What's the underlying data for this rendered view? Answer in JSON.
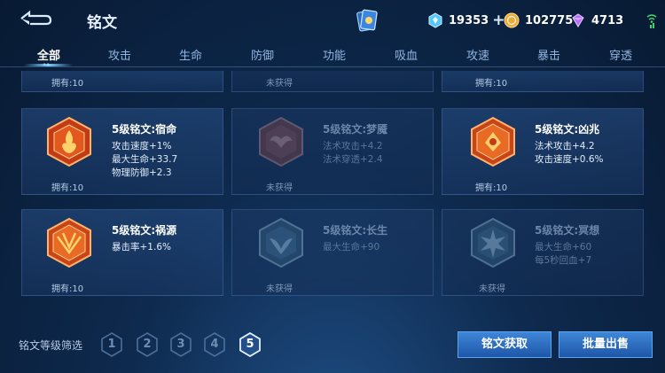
{
  "header": {
    "title": "铭文",
    "currencies": [
      {
        "name": "diamond",
        "value": "19353"
      },
      {
        "name": "gold",
        "value": "102775"
      },
      {
        "name": "gem",
        "value": "4713"
      }
    ],
    "plus": "+"
  },
  "tabs": [
    "全部",
    "攻击",
    "生命",
    "防御",
    "功能",
    "吸血",
    "攻速",
    "暴击",
    "穿透"
  ],
  "tab_dots": "••",
  "runes": {
    "top_row": [
      {
        "status": "拥有:10"
      },
      {
        "status": "未获得"
      },
      {
        "status": "拥有:10"
      }
    ],
    "row1": [
      {
        "name": "5级铭文:宿命",
        "stats": [
          "攻击速度+1%",
          "最大生命+33.7",
          "物理防御+2.3"
        ],
        "status": "拥有:10",
        "color": "#d8431e"
      },
      {
        "name": "5级铭文:梦魇",
        "stats": [
          "法术攻击+4.2",
          "法术穿透+2.4"
        ],
        "status": "未获得",
        "color": "#8a5a66"
      },
      {
        "name": "5级铭文:凶兆",
        "stats": [
          "法术攻击+4.2",
          "攻击速度+0.6%"
        ],
        "status": "拥有:10",
        "color": "#e0561e"
      }
    ],
    "row2": [
      {
        "name": "5级铭文:祸源",
        "stats": [
          "暴击率+1.6%"
        ],
        "status": "拥有:10",
        "color": "#e0561e"
      },
      {
        "name": "5级铭文:长生",
        "stats": [
          "最大生命+90"
        ],
        "status": "未获得",
        "color": "#4e7a9a"
      },
      {
        "name": "5级铭文:冥想",
        "stats": [
          "最大生命+60",
          "每5秒回血+7"
        ],
        "status": "未获得",
        "color": "#4e7a9a"
      }
    ]
  },
  "filter": {
    "label": "铭文等级筛选",
    "levels": [
      "1",
      "2",
      "3",
      "4",
      "5"
    ],
    "active": "5"
  },
  "buttons": {
    "get": "铭文获取",
    "sell": "批量出售"
  },
  "colors": {
    "accent": "#3f86d8",
    "owned_emblem": "#e0561e"
  }
}
